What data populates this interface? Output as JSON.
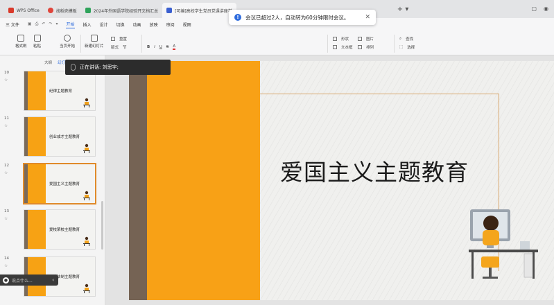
{
  "tabs": [
    {
      "label": "WPS Office",
      "color": "#d93a2b",
      "active": false
    },
    {
      "label": "找稻壳模板",
      "color": "#e0443a",
      "active": false
    },
    {
      "label": "2024年外国语学院经验开文档汇总",
      "color": "#2fa35b",
      "active": false
    },
    {
      "label": "[可编]高校学生党员党课讲座学",
      "color": "#3a5fd0",
      "active": true
    }
  ],
  "menu": {
    "file": "三 文件",
    "items": [
      "开始",
      "插入",
      "设计",
      "切换",
      "动画",
      "放映",
      "审阅",
      "视图"
    ],
    "active": "开始"
  },
  "ribbon": {
    "format_painter": "格式刷",
    "paste": "粘贴",
    "from_current": "当页开始",
    "new_slide": "新建幻灯片",
    "layout": "版式",
    "section": "节",
    "reset": "重置",
    "textbox_group": "形状",
    "textbox": "文本框",
    "arrange": "排列",
    "picture": "图片",
    "find": "查找",
    "select": "选择"
  },
  "toast": {
    "message": "会议已超过2人，自动转为60分钟限时会议。"
  },
  "speaking": {
    "text": "正在讲话: 刘思宇;"
  },
  "panel": {
    "tab_outline": "大纲",
    "tab_slides": "幻灯片"
  },
  "thumbnails": [
    {
      "num": "10",
      "title": "纪律主题教育",
      "selected": false
    },
    {
      "num": "11",
      "title": "创业成才主题教育",
      "selected": false
    },
    {
      "num": "12",
      "title": "爱国主义主题教育",
      "selected": true
    },
    {
      "num": "13",
      "title": "爱校荣校主题教育",
      "selected": false
    },
    {
      "num": "14",
      "title": "安全法制主题教育",
      "selected": false
    }
  ],
  "slide": {
    "title": "爱国主义主题教育"
  },
  "comment": {
    "placeholder": "说点什么..."
  }
}
